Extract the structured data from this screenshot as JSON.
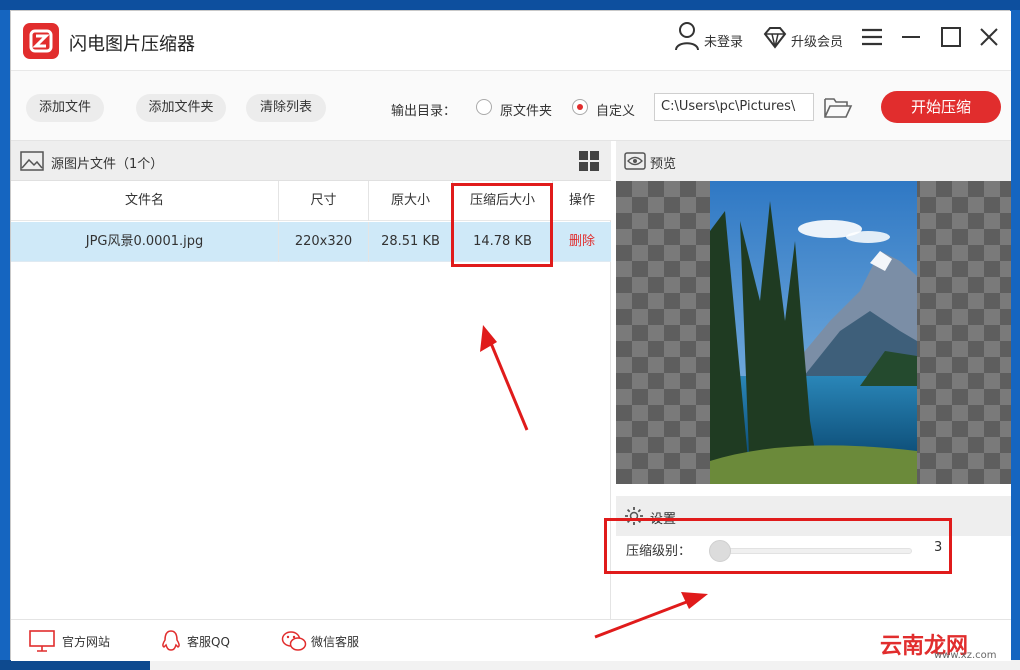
{
  "app": {
    "title": "闪电图片压缩器",
    "user_label": "未登录",
    "vip_label": "升级会员"
  },
  "toolbar": {
    "add_file": "添加文件",
    "add_folder": "添加文件夹",
    "clear_list": "清除列表",
    "output_label": "输出目录：",
    "option_original": "原文件夹",
    "option_custom": "自定义",
    "selected_option": "自定义",
    "path_value": "C:\\Users\\pc\\Pictures\\",
    "start_button": "开始压缩"
  },
  "source_panel": {
    "title": "源图片文件（1个）",
    "columns": [
      "文件名",
      "尺寸",
      "原大小",
      "压缩后大小",
      "操作"
    ],
    "rows": [
      {
        "name": "JPG风景0.0001.jpg",
        "size": "220x320",
        "original": "28.51 KB",
        "compressed": "14.78 KB",
        "action": "删除"
      }
    ]
  },
  "preview": {
    "title": "预览"
  },
  "settings": {
    "title": "设置",
    "level_label": "压缩级别：",
    "level_value": "3"
  },
  "footer": {
    "website": "官方网站",
    "qq": "客服QQ",
    "wechat": "微信客服"
  },
  "watermarks": {
    "brand": "云南龙网",
    "site": "www.xz.com"
  },
  "colors": {
    "accent": "#e12d2d",
    "row_selected": "#cfe9f8",
    "annotation": "#e01b1b"
  }
}
